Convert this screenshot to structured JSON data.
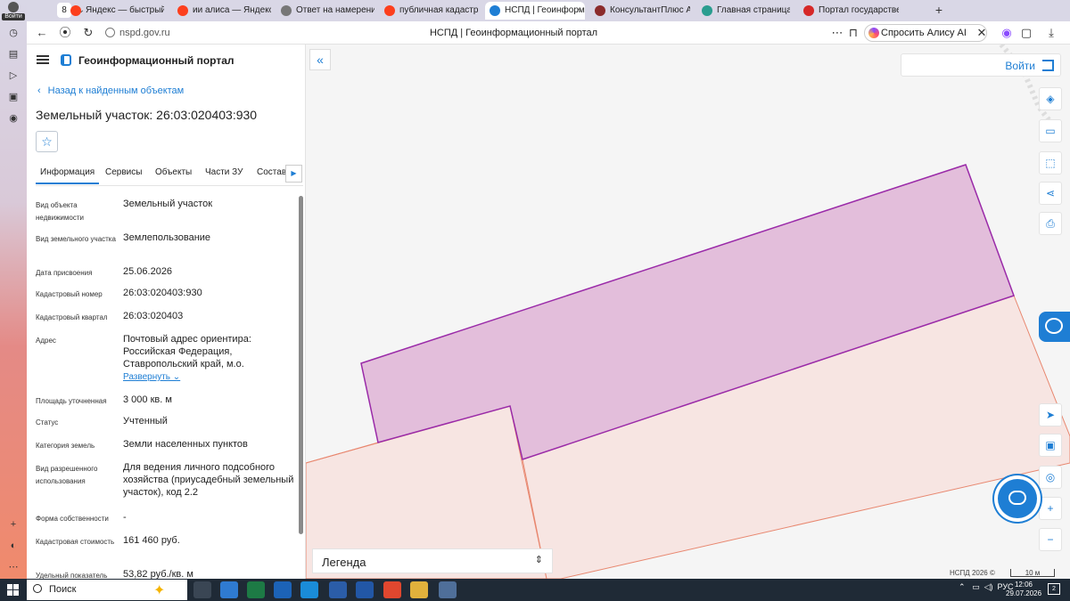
{
  "browser": {
    "avatar_label": "Войти",
    "tab_count": "8",
    "tabs": [
      {
        "label": "Яндекс — быстрый пои",
        "color": "#fc3f1d"
      },
      {
        "label": "ии алиса — Яндекс: на",
        "color": "#fc3f1d"
      },
      {
        "label": "Ответ на намерение у",
        "color": "#777777"
      },
      {
        "label": "публичная кадастрова",
        "color": "#fc3f1d"
      },
      {
        "label": "НСПД | Геоинформа",
        "color": "#1e7ed4"
      },
      {
        "label": "КонсультантПлюс Авто",
        "color": "#8b2b2b"
      },
      {
        "label": "Главная страница",
        "color": "#2a9d8f"
      },
      {
        "label": "Портал государственн",
        "color": "#d62828"
      }
    ],
    "url": "nspd.gov.ru",
    "page_title": "НСПД | Геоинформационный портал",
    "alice_label": "Спросить Алису AI"
  },
  "panel": {
    "portal_name": "Геоинформационный портал",
    "back_label": "Назад к найденным объектам",
    "title": "Земельный участок: 26:03:020403:930",
    "tabs": [
      "Информация",
      "Сервисы",
      "Объекты",
      "Части ЗУ",
      "Состав"
    ],
    "properties": [
      {
        "label": "Вид объекта недвижимости",
        "value": "Земельный участок"
      },
      {
        "label": "Вид земельного участка",
        "value": "Землепользование"
      },
      {
        "label": "Дата присвоения",
        "value": "25.06.2026"
      },
      {
        "label": "Кадастровый номер",
        "value": "26:03:020403:930"
      },
      {
        "label": "Кадастровый квартал",
        "value": "26:03:020403"
      },
      {
        "label": "Адрес",
        "value": "Почтовый адрес ориентира: Российская Федерация, Ставропольский край, м.о."
      },
      {
        "label": "Площадь уточненная",
        "value": "3 000 кв. м"
      },
      {
        "label": "Статус",
        "value": "Учтенный"
      },
      {
        "label": "Категория земель",
        "value": "Земли населенных пунктов"
      },
      {
        "label": "Вид разрешенного использования",
        "value": "Для ведения личного подсобного хозяйства (приусадебный земельный участок), код 2.2"
      },
      {
        "label": "Форма собственности",
        "value": "-"
      },
      {
        "label": "Кадастровая стоимость",
        "value": "161 460 руб."
      },
      {
        "label": "Удельный показатель",
        "value": "53,82 руб./кв. м"
      }
    ],
    "expand_label": "Развернуть"
  },
  "map": {
    "login_label": "Войти",
    "legend_label": "Легенда",
    "copyright": "НСПД 2026 ©",
    "scale_label": "10 м",
    "colors": {
      "selected_fill": "#e3bedb",
      "selected_stroke": "#9a2aa8",
      "other_fill": "#f7e5e2",
      "other_stroke": "#e8876f"
    }
  },
  "taskbar": {
    "search_placeholder": "Поиск",
    "lang": "РУС",
    "time": "12:06",
    "date": "29.07.2026",
    "notifications": "2"
  }
}
